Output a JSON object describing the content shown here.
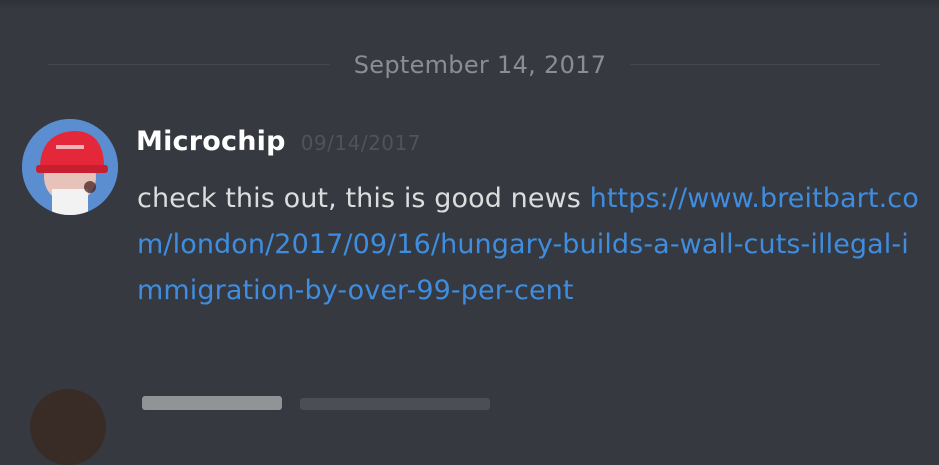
{
  "divider": {
    "date": "September 14, 2017"
  },
  "message": {
    "author": "Microchip",
    "timestamp": "09/14/2017",
    "text": "check this out, this is good news ",
    "link": "https://www.breitbart.com/london/2017/09/16/hungary-builds-a-wall-cuts-illegal-immigration-by-over-99-per-cent"
  },
  "colors": {
    "background": "#36393f",
    "author": "#ffffff",
    "text": "#dcddde",
    "link": "#3f8de0",
    "muted": "#8a8d92"
  },
  "icons": {
    "avatar": "avatar-red-cap"
  }
}
